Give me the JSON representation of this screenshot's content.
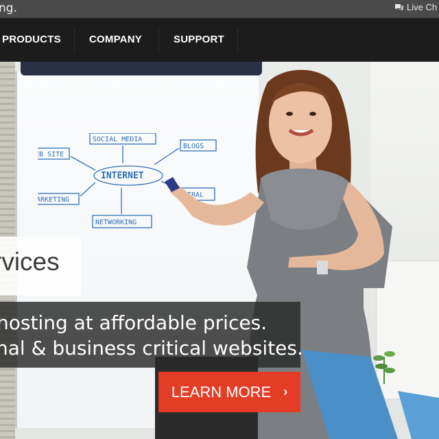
{
  "topbar": {
    "tagline_partial": "ng.",
    "live_chat_label": "Live Ch"
  },
  "nav": {
    "items": [
      {
        "label": "PRODUCTS"
      },
      {
        "label": "COMPANY"
      },
      {
        "label": "SUPPORT"
      }
    ]
  },
  "hero": {
    "title_partial": "rvices",
    "tagline_line1": "hosting at affordable prices.",
    "tagline_line2": "nal & business critical websites.",
    "cta_label": "LEARN MORE",
    "cta_icon": "chevron-right-icon",
    "whiteboard_words": [
      "SOCIAL MEDIA",
      "BLOGS",
      "WEB SITE",
      "INTERNET",
      "VIRAL",
      "MARKETING",
      "NETWORKING"
    ]
  },
  "colors": {
    "topbar": "#4a4a4a",
    "navbar": "#1c1c1c",
    "cta": "#e43d26",
    "board_ink": "#2f6fb5"
  }
}
